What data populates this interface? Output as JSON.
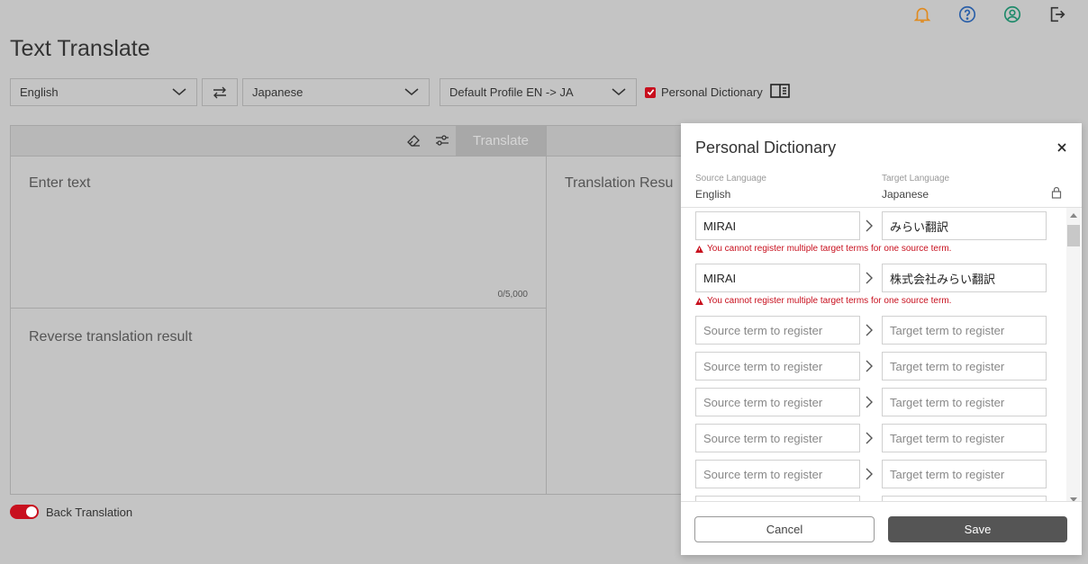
{
  "header": {
    "title": "Text Translate",
    "icons": [
      "bell-icon",
      "help-icon",
      "account-icon",
      "logout-icon"
    ]
  },
  "toolbar": {
    "source_lang": "English",
    "target_lang": "Japanese",
    "profile": "Default Profile EN -> JA",
    "personal_dictionary_label": "Personal Dictionary",
    "personal_dictionary_checked": true
  },
  "editor": {
    "translate_label": "Translate",
    "input_placeholder": "Enter text",
    "char_counter": "0/5,000",
    "reverse_placeholder": "Reverse translation result",
    "translation_result_label": "Translation Resu"
  },
  "back_translation": {
    "label": "Back Translation",
    "enabled": true
  },
  "dictionary_modal": {
    "title": "Personal Dictionary",
    "source_language_label": "Source Language",
    "source_language": "English",
    "target_language_label": "Target Language",
    "target_language": "Japanese",
    "entries": [
      {
        "source": "MIRAI",
        "target": "みらい翻訳",
        "error": "You cannot register multiple target terms for one source term."
      },
      {
        "source": "MIRAI",
        "target": "株式会社みらい翻訳",
        "error": "You cannot register multiple target terms for one source term."
      }
    ],
    "source_placeholder": "Source term to register",
    "target_placeholder": "Target term to register",
    "cancel_label": "Cancel",
    "save_label": "Save"
  },
  "colors": {
    "accent": "#c8101e",
    "bell": "#e08a1e",
    "help": "#2a5fa8",
    "account": "#1e8a6a"
  }
}
